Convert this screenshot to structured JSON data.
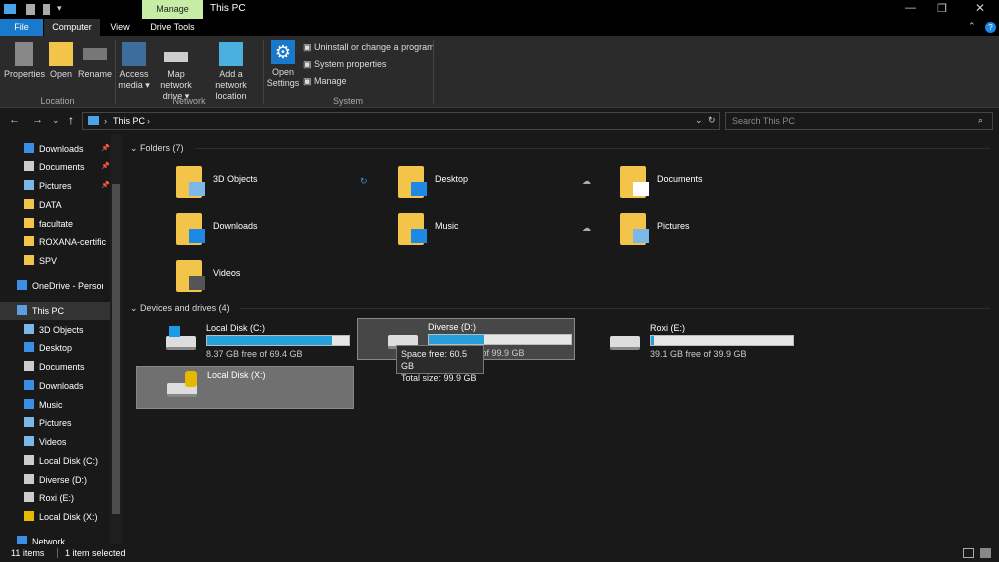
{
  "title": "This PC",
  "manage_tab": "Manage",
  "tabs": [
    "File",
    "Computer",
    "View",
    "Drive Tools"
  ],
  "ribbon": {
    "location": {
      "label": "Location",
      "buttons": [
        "Properties",
        "Open",
        "Rename"
      ]
    },
    "network": {
      "label": "Network",
      "access_media": "Access media",
      "map_drive": "Map network drive",
      "add_location": "Add a network location"
    },
    "system": {
      "label": "System",
      "open_settings": "Open Settings",
      "uninstall": "Uninstall or change a program",
      "properties": "System properties",
      "manage": "Manage"
    }
  },
  "address": {
    "path": "This PC",
    "search_placeholder": "Search This PC"
  },
  "nav": [
    {
      "label": "Downloads",
      "pin": true,
      "color": "#3a8ee6"
    },
    {
      "label": "Documents",
      "pin": true,
      "color": "#ccc"
    },
    {
      "label": "Pictures",
      "pin": true,
      "color": "#7bb8e8"
    },
    {
      "label": "DATA",
      "color": "#f2c54a"
    },
    {
      "label": "facultate",
      "color": "#f2c54a"
    },
    {
      "label": "ROXANA-certific",
      "color": "#f2c54a"
    },
    {
      "label": "SPV",
      "color": "#f2c54a"
    },
    {
      "label": "OneDrive - Person",
      "color": "#3a8ee6"
    },
    {
      "label": "This PC",
      "color": "#5aa0e0"
    },
    {
      "label": "3D Objects",
      "color": "#7bb8e8"
    },
    {
      "label": "Desktop",
      "color": "#3a8ee6"
    },
    {
      "label": "Documents",
      "color": "#ccc"
    },
    {
      "label": "Downloads",
      "color": "#3a8ee6"
    },
    {
      "label": "Music",
      "color": "#3a8ee6"
    },
    {
      "label": "Pictures",
      "color": "#7bb8e8"
    },
    {
      "label": "Videos",
      "color": "#7bb8e8"
    },
    {
      "label": "Local Disk (C:)",
      "color": "#ccc"
    },
    {
      "label": "Diverse (D:)",
      "color": "#ccc"
    },
    {
      "label": "Roxi (E:)",
      "color": "#ccc"
    },
    {
      "label": "Local Disk (X:)",
      "color": "#e6b800"
    },
    {
      "label": "Network",
      "color": "#3a8ee6"
    }
  ],
  "folders_header": "Folders (7)",
  "folders": [
    "3D Objects",
    "Desktop",
    "Documents",
    "Downloads",
    "Music",
    "Pictures",
    "Videos"
  ],
  "drives_header": "Devices and drives (4)",
  "drives": [
    {
      "name": "Local Disk (C:)",
      "free": "8.37 GB free of 69.4 GB",
      "used_pct": 88
    },
    {
      "name": "Diverse (D:)",
      "free": "60.5 GB free of 99.9 GB",
      "used_pct": 39
    },
    {
      "name": "Roxi (E:)",
      "free": "39.1 GB free of 39.9 GB",
      "used_pct": 2
    },
    {
      "name": "Local Disk (X:)"
    }
  ],
  "tooltip": {
    "free": "Space free: 60.5 GB",
    "total": "Total size: 99.9 GB"
  },
  "status": {
    "items": "11 items",
    "selected": "1 item selected"
  }
}
